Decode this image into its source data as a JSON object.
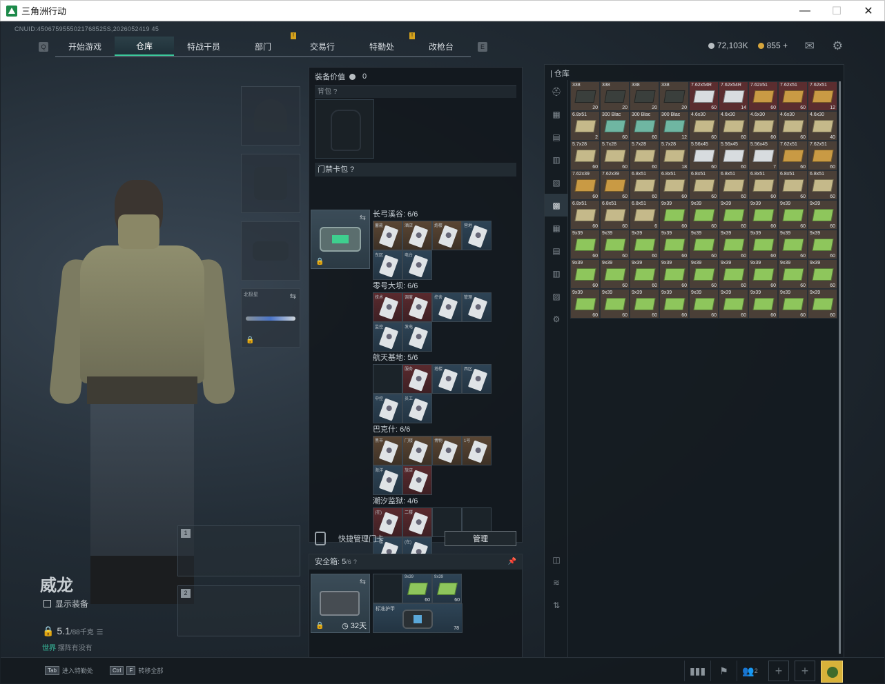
{
  "window": {
    "title": "三角洲行动",
    "minimize": "—",
    "maximize": "☐",
    "close": "✕"
  },
  "uid": "CNUID:4506759555021768525S,2026052419 45",
  "nav": {
    "left_key": "Q",
    "right_key": "E",
    "tabs": [
      {
        "label": "开始游戏",
        "active": false,
        "warn": false
      },
      {
        "label": "仓库",
        "active": true,
        "warn": false
      },
      {
        "label": "特战干员",
        "active": false,
        "warn": false
      },
      {
        "label": "部门",
        "active": false,
        "warn": true
      },
      {
        "label": "交易行",
        "active": false,
        "warn": false
      },
      {
        "label": "特勤处",
        "active": false,
        "warn": true
      },
      {
        "label": "改枪台",
        "active": false,
        "warn": false
      }
    ]
  },
  "currency": {
    "silver": "72,103K",
    "gold": "855",
    "plus": "+"
  },
  "icons": {
    "mail": "✉",
    "settings": "⚙"
  },
  "character": {
    "name": "威龙",
    "show_equipment": "显示装备",
    "weight": "5.1",
    "weight_max": "/88千克",
    "status_green": "世界",
    "status_rest": "摆阵有没有"
  },
  "equip_slots": {
    "melee_name": "北极星"
  },
  "gun_slots": [
    "1",
    "2"
  ],
  "mid": {
    "equip_value_label": "装备价值",
    "equip_value": "0",
    "backpack_label": "背包",
    "keycard_label": "门禁卡包",
    "rooms": [
      {
        "title": "长弓溪谷: 6/6",
        "cells": [
          "gold",
          "gold",
          "gold",
          "blue",
          "blue",
          "blue"
        ],
        "labels": [
          "蓄能",
          "酒店",
          "炮楼",
          "营地",
          "东区",
          "电台"
        ]
      },
      {
        "title": "零号大坝: 6/6",
        "cells": [
          "red",
          "red",
          "blue",
          "blue",
          "blue",
          "blue"
        ],
        "labels": [
          "技术",
          "调度",
          "控舍",
          "管理",
          "监控",
          "发电"
        ]
      },
      {
        "title": "航天基地: 5/6",
        "cells": [
          "empty",
          "red",
          "blue",
          "blue",
          "blue",
          "blue"
        ],
        "labels": [
          "",
          "服务",
          "塔楼",
          "西区",
          "中控",
          "员工"
        ]
      },
      {
        "title": "巴克什: 6/6",
        "cells": [
          "gold",
          "gold",
          "gold",
          "gold",
          "blue",
          "red"
        ],
        "labels": [
          "黑市",
          "门楼",
          "博物",
          "1号",
          "海洋",
          "旅店"
        ]
      },
      {
        "title": "潮汐监狱: 4/6",
        "cells": [
          "red",
          "red",
          "empty",
          "empty",
          "blue",
          "blue"
        ],
        "labels": [
          "(在)",
          "二楼",
          "",
          "",
          "一楼",
          "(在)"
        ]
      }
    ],
    "quick_manage": "快捷管理门卡",
    "manage_btn": "管理"
  },
  "safebox": {
    "title": "安全箱:",
    "count": "5",
    "total": "/6",
    "help": "?",
    "timer": "32天",
    "items": [
      {
        "label": "9x39",
        "count": "60"
      },
      {
        "label": "9x39",
        "count": "60"
      }
    ],
    "vest_label": "标准护甲",
    "vest_dur": "78"
  },
  "warehouse": {
    "title": "仓库",
    "rows": [
      [
        {
          "l": "338",
          "c": "20",
          "t": "dark"
        },
        {
          "l": "338",
          "c": "20",
          "t": "dark"
        },
        {
          "l": "338",
          "c": "20",
          "t": "dark"
        },
        {
          "l": "338",
          "c": "20",
          "t": "dark"
        },
        {
          "l": "7.62x54R",
          "c": "60",
          "t": "white"
        },
        {
          "l": "7.62x54R",
          "c": "14",
          "t": "white"
        },
        {
          "l": "7.62x51",
          "c": "60",
          "t": "orange"
        },
        {
          "l": "7.62x51",
          "c": "60",
          "t": "orange"
        },
        {
          "l": "7.62x51",
          "c": "12",
          "t": "orange"
        }
      ],
      [
        {
          "l": "6.8x51",
          "c": "2",
          "t": "tan"
        },
        {
          "l": "300 Blac",
          "c": "60",
          "t": "teal"
        },
        {
          "l": "300 Blac",
          "c": "60",
          "t": "teal"
        },
        {
          "l": "300 Blac",
          "c": "12",
          "t": "teal"
        },
        {
          "l": "4.6x30",
          "c": "60",
          "t": "tan"
        },
        {
          "l": "4.6x30",
          "c": "60",
          "t": "tan"
        },
        {
          "l": "4.6x30",
          "c": "60",
          "t": "tan"
        },
        {
          "l": "4.6x30",
          "c": "60",
          "t": "tan"
        },
        {
          "l": "4.6x30",
          "c": "40",
          "t": "tan"
        }
      ],
      [
        {
          "l": "5.7x28",
          "c": "60",
          "t": "tan"
        },
        {
          "l": "5.7x28",
          "c": "60",
          "t": "tan"
        },
        {
          "l": "5.7x28",
          "c": "60",
          "t": "tan"
        },
        {
          "l": "5.7x28",
          "c": "18",
          "t": "tan"
        },
        {
          "l": "5.56x45",
          "c": "60",
          "t": "white"
        },
        {
          "l": "5.56x45",
          "c": "60",
          "t": "white"
        },
        {
          "l": "5.56x45",
          "c": "7",
          "t": "white"
        },
        {
          "l": "7.62x51",
          "c": "60",
          "t": "orange"
        },
        {
          "l": "7.62x51",
          "c": "60",
          "t": "orange"
        }
      ],
      [
        {
          "l": "7.62x39",
          "c": "60",
          "t": "orange"
        },
        {
          "l": "7.62x39",
          "c": "60",
          "t": "orange"
        },
        {
          "l": "6.8x51",
          "c": "60",
          "t": "tan"
        },
        {
          "l": "6.8x51",
          "c": "60",
          "t": "tan"
        },
        {
          "l": "6.8x51",
          "c": "60",
          "t": "tan"
        },
        {
          "l": "6.8x51",
          "c": "60",
          "t": "tan"
        },
        {
          "l": "6.8x51",
          "c": "60",
          "t": "tan"
        },
        {
          "l": "6.8x51",
          "c": "60",
          "t": "tan"
        },
        {
          "l": "6.8x51",
          "c": "60",
          "t": "tan"
        }
      ],
      [
        {
          "l": "6.8x51",
          "c": "60",
          "t": "tan"
        },
        {
          "l": "6.8x51",
          "c": "60",
          "t": "tan"
        },
        {
          "l": "6.8x51",
          "c": "6",
          "t": "tan"
        },
        {
          "l": "9x39",
          "c": "60",
          "t": "green"
        },
        {
          "l": "9x39",
          "c": "60",
          "t": "green"
        },
        {
          "l": "9x39",
          "c": "60",
          "t": "green"
        },
        {
          "l": "9x39",
          "c": "60",
          "t": "green"
        },
        {
          "l": "9x39",
          "c": "60",
          "t": "green"
        },
        {
          "l": "9x39",
          "c": "60",
          "t": "green"
        }
      ],
      [
        {
          "l": "9x39",
          "c": "60",
          "t": "green"
        },
        {
          "l": "9x39",
          "c": "60",
          "t": "green"
        },
        {
          "l": "9x39",
          "c": "60",
          "t": "green"
        },
        {
          "l": "9x39",
          "c": "60",
          "t": "green"
        },
        {
          "l": "9x39",
          "c": "60",
          "t": "green"
        },
        {
          "l": "9x39",
          "c": "60",
          "t": "green"
        },
        {
          "l": "9x39",
          "c": "60",
          "t": "green"
        },
        {
          "l": "9x39",
          "c": "60",
          "t": "green"
        },
        {
          "l": "9x39",
          "c": "60",
          "t": "green"
        }
      ],
      [
        {
          "l": "9x39",
          "c": "60",
          "t": "green"
        },
        {
          "l": "9x39",
          "c": "60",
          "t": "green"
        },
        {
          "l": "9x39",
          "c": "60",
          "t": "green"
        },
        {
          "l": "9x39",
          "c": "60",
          "t": "green"
        },
        {
          "l": "9x39",
          "c": "60",
          "t": "green"
        },
        {
          "l": "9x39",
          "c": "60",
          "t": "green"
        },
        {
          "l": "9x39",
          "c": "60",
          "t": "green"
        },
        {
          "l": "9x39",
          "c": "60",
          "t": "green"
        },
        {
          "l": "9x39",
          "c": "60",
          "t": "green"
        }
      ],
      [
        {
          "l": "9x39",
          "c": "60",
          "t": "green"
        },
        {
          "l": "9x39",
          "c": "60",
          "t": "green"
        },
        {
          "l": "9x39",
          "c": "60",
          "t": "green"
        },
        {
          "l": "9x39",
          "c": "60",
          "t": "green"
        },
        {
          "l": "9x39",
          "c": "60",
          "t": "green"
        },
        {
          "l": "9x39",
          "c": "60",
          "t": "green"
        },
        {
          "l": "9x39",
          "c": "60",
          "t": "green"
        },
        {
          "l": "9x39",
          "c": "60",
          "t": "green"
        },
        {
          "l": "9x39",
          "c": "60",
          "t": "green"
        }
      ]
    ],
    "colors": {
      "dark": "#3a3f3c",
      "white": "#d8dcdf",
      "orange": "#c99a44",
      "tan": "#c5b98a",
      "teal": "#6fb6a2",
      "green": "#8ec65c"
    }
  },
  "bottom": {
    "hint1_key": "Tab",
    "hint1": "进入特勤处",
    "hint2_key1": "Ctrl",
    "hint2_key2": "F",
    "hint2": "转移全部",
    "party_count": "2"
  }
}
